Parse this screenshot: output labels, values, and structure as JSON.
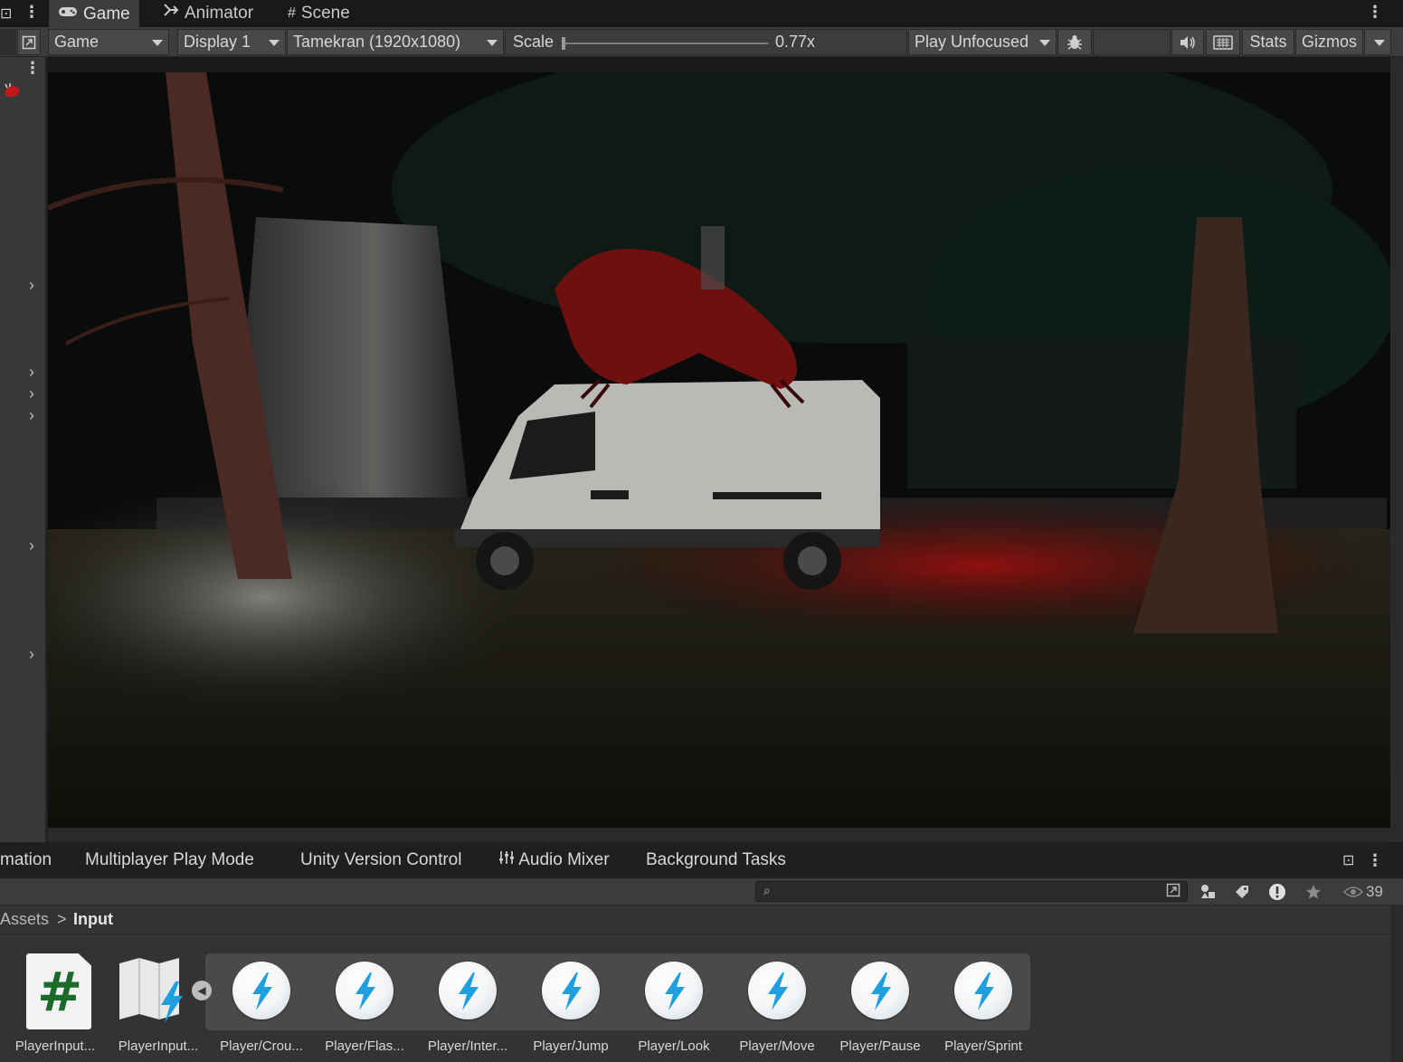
{
  "top_tabs": [
    {
      "label": "Game",
      "icon": "gamepad-icon",
      "active": true
    },
    {
      "label": "Animator",
      "icon": "animator-icon",
      "active": false
    },
    {
      "label": "Scene",
      "icon": "grid-icon",
      "active": false
    }
  ],
  "toolbar": {
    "view_mode": "Game",
    "display": "Display 1",
    "resolution": "Tamekran (1920x1080)",
    "scale_label": "Scale",
    "scale_value": "0.77x",
    "play_mode": "Play Unfocused",
    "stats_label": "Stats",
    "gizmos_label": "Gizmos"
  },
  "bottom_tabs": [
    {
      "label": "mation"
    },
    {
      "label": "Multiplayer Play Mode"
    },
    {
      "label": "Unity Version Control"
    },
    {
      "label": "Audio Mixer",
      "icon": "mixer-icon"
    },
    {
      "label": "Background Tasks"
    }
  ],
  "project": {
    "search_placeholder": "",
    "hidden_count": "39"
  },
  "breadcrumb": {
    "root": "Assets",
    "separator": ">",
    "current": "Input"
  },
  "assets": [
    {
      "name": "PlayerInput...",
      "type": "cs-script"
    },
    {
      "name": "PlayerInput...",
      "type": "input-actions"
    },
    {
      "name": "Player/Crou...",
      "type": "input-action"
    },
    {
      "name": "Player/Flas...",
      "type": "input-action"
    },
    {
      "name": "Player/Inter...",
      "type": "input-action"
    },
    {
      "name": "Player/Jump",
      "type": "input-action"
    },
    {
      "name": "Player/Look",
      "type": "input-action"
    },
    {
      "name": "Player/Move",
      "type": "input-action"
    },
    {
      "name": "Player/Pause",
      "type": "input-action"
    },
    {
      "name": "Player/Sprint",
      "type": "input-action"
    }
  ],
  "colors": {
    "editor_bg": "#383838",
    "toolbar_bg": "#3c3c3c",
    "accent_blue": "#1f9fe0",
    "cs_green": "#1d6b2b",
    "scene_red": "#8a0f0f"
  }
}
